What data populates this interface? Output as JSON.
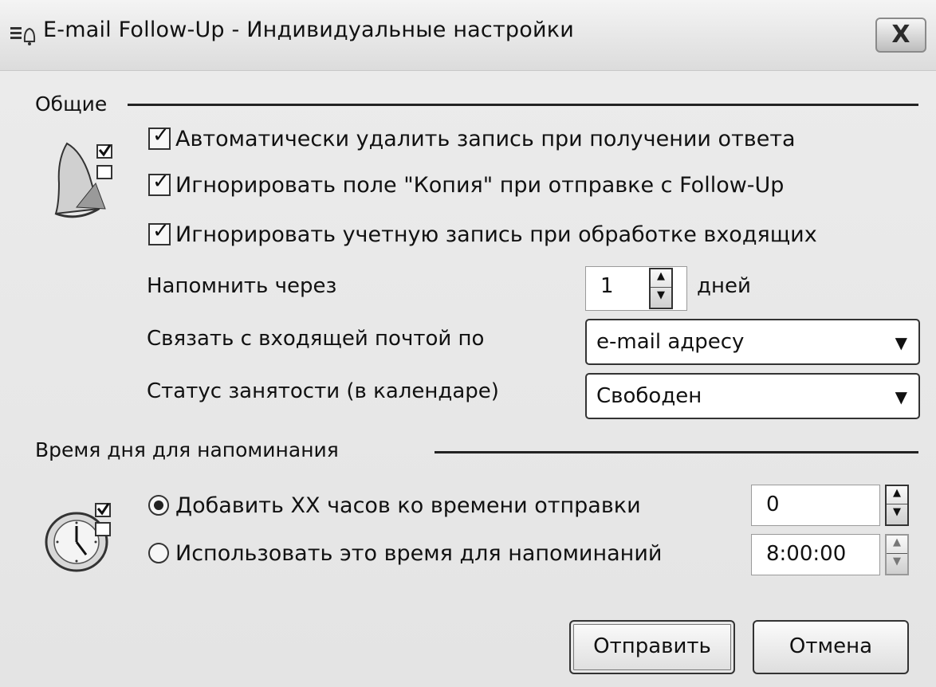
{
  "window": {
    "title": "E-mail Follow-Up - Индивидуальные настройки",
    "close_label": "X"
  },
  "general": {
    "section_label": "Общие",
    "options": [
      {
        "label": "Автоматически удалить запись при получении ответа",
        "checked": true
      },
      {
        "label": "Игнорировать поле \"Копия\" при отправке с Follow-Up",
        "checked": true
      },
      {
        "label": "Игнорировать учетную запись при обработке входящих",
        "checked": true
      }
    ],
    "remind": {
      "label": "Напомнить через",
      "value": "1",
      "unit": "дней"
    },
    "link": {
      "label": "Связать с входящей почтой по",
      "value": "e-mail адресу"
    },
    "busy": {
      "label": "Статус занятости (в календаре)",
      "value": "Свободен"
    }
  },
  "time": {
    "section_label": "Время дня для напоминания",
    "add_hours": {
      "label": "Добавить XX часов ко времени отправки",
      "value": "0",
      "selected": true
    },
    "use_time": {
      "label": "Использовать это время для напоминаний",
      "value": "8:00:00",
      "selected": false
    }
  },
  "buttons": {
    "send": "Отправить",
    "cancel": "Отмена"
  },
  "icons": {
    "title": "settings-icon",
    "general": "bell-icon",
    "time": "clock-icon"
  }
}
